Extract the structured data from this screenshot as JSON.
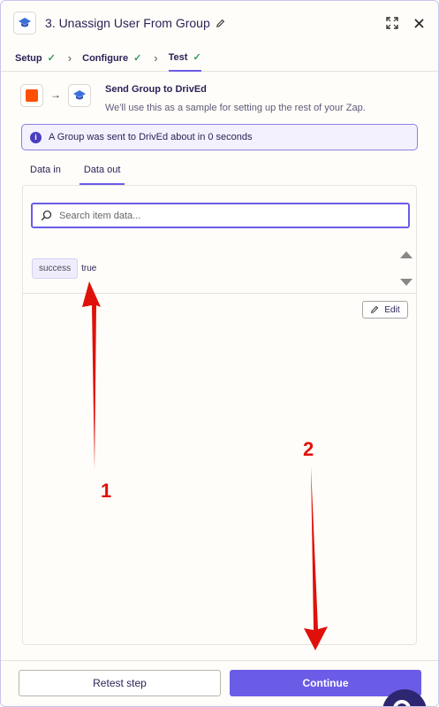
{
  "header": {
    "title": "3. Unassign User From Group",
    "icons": [
      "graduation-cap-icon",
      "pencil-icon",
      "expand-icon",
      "close-icon"
    ]
  },
  "steps": [
    {
      "label": "Setup",
      "done": true
    },
    {
      "label": "Configure",
      "done": true
    },
    {
      "label": "Test",
      "done": true,
      "active": true
    }
  ],
  "action": {
    "title": "Send Group to DrivEd",
    "subtitle": "We'll use this as a sample for setting up the rest of your Zap."
  },
  "info": {
    "icon": "info-icon",
    "text": "A Group was sent to DrivEd about in 0 seconds"
  },
  "tabs": [
    {
      "label": "Data in",
      "active": false
    },
    {
      "label": "Data out",
      "active": true
    }
  ],
  "data_out": {
    "search_placeholder": "Search item data...",
    "rows": [
      {
        "key": "success",
        "value": "true"
      }
    ],
    "edit_label": "Edit"
  },
  "footer": {
    "retest_label": "Retest step",
    "continue_label": "Continue"
  },
  "annotations": {
    "arrow1_label": "1",
    "arrow2_label": "2",
    "color": "#e0100a"
  },
  "colors": {
    "accent": "#6b5ce7",
    "zapier_orange": "#ff4f00",
    "check_green": "#2e9b5a"
  }
}
